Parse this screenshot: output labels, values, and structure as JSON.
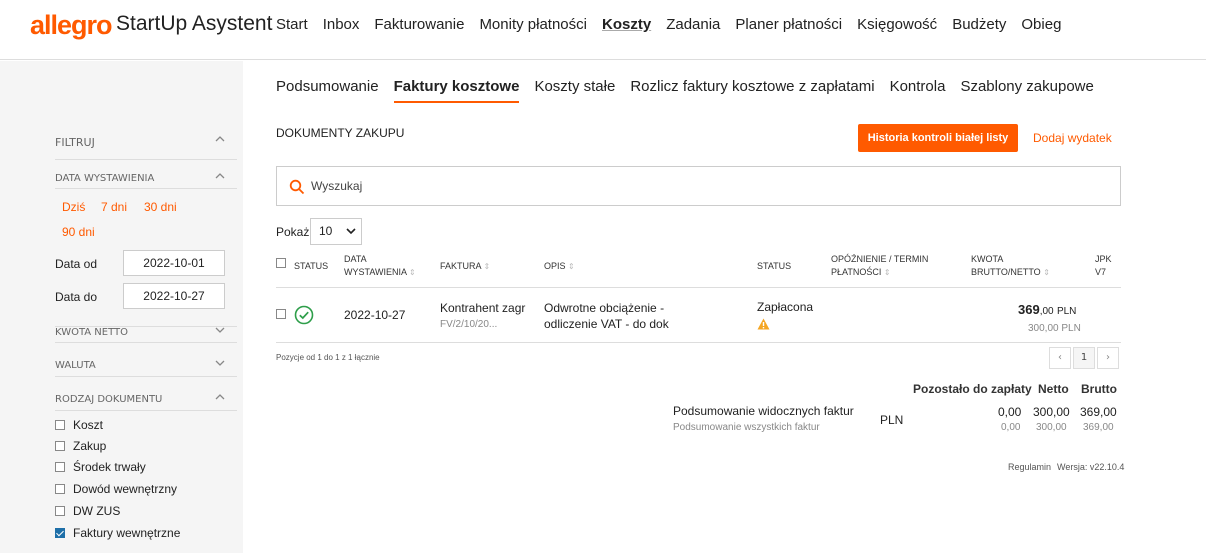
{
  "header": {
    "logo": "allegro",
    "app_name": "StartUp Asystent",
    "nav": [
      "Start",
      "Inbox",
      "Fakturowanie",
      "Monity płatności",
      "Koszty",
      "Zadania",
      "Planer płatności",
      "Księgowość",
      "Budżety",
      "Obieg"
    ],
    "active_nav": "Koszty"
  },
  "subnav": {
    "items": [
      "Podsumowanie",
      "Faktury kosztowe",
      "Koszty stałe",
      "Rozlicz faktury kosztowe z zapłatami",
      "Kontrola",
      "Szablony zakupowe"
    ],
    "active": "Faktury kosztowe"
  },
  "sidebar": {
    "filter_title": "FILTRUJ",
    "date_section": "DATA WYSTAWIENIA",
    "quick": [
      "Dziś",
      "7 dni",
      "30 dni",
      "90 dni"
    ],
    "date_from_label": "Data od",
    "date_from": "2022-10-01",
    "date_to_label": "Data do",
    "date_to": "2022-10-27",
    "net_amount": "KWOTA NETTO",
    "currency": "WALUTA",
    "doc_type": "RODZAJ DOKUMENTU",
    "doc_types": [
      {
        "label": "Koszt",
        "checked": false
      },
      {
        "label": "Zakup",
        "checked": false
      },
      {
        "label": "Środek trwały",
        "checked": false
      },
      {
        "label": "Dowód wewnętrzny",
        "checked": false
      },
      {
        "label": "DW ZUS",
        "checked": false
      },
      {
        "label": "Faktury wewnętrzne",
        "checked": true
      }
    ]
  },
  "main": {
    "section_title": "DOKUMENTY ZAKUPU",
    "btn_history": "Historia kontroli białej listy",
    "btn_add": "Dodaj wydatek",
    "search_placeholder": "Wyszukaj",
    "show_label": "Pokaż",
    "page_size": "10",
    "columns": {
      "status": "STATUS",
      "date_1": "DATA",
      "date_2": "WYSTAWIENIA",
      "invoice": "FAKTURA",
      "desc": "OPIS",
      "status2": "STATUS",
      "delay_1": "OPÓŹNIENIE / TERMIN",
      "delay_2": "PŁATNOŚCI",
      "amount_1": "KWOTA",
      "amount_2": "BRUTTO/NETTO",
      "jpk_1": "JPK",
      "jpk_2": "V7"
    },
    "row": {
      "date": "2022-10-27",
      "contractor": "Kontrahent zagr",
      "invoice_no": "FV/2/10/20...",
      "desc_1": "Odwrotne obciążenie -",
      "desc_2": "odliczenie VAT - do dok",
      "status": "Zapłacona",
      "gross_int": "369",
      "gross_dec": ",00",
      "gross_cur": "PLN",
      "net": "300,00 PLN"
    },
    "positions": "Pozycje od 1 do 1 z 1 łącznie",
    "page_prev": "‹",
    "page_current": "1",
    "page_next": "›"
  },
  "summary": {
    "col_remaining": "Pozostało do zapłaty",
    "col_net": "Netto",
    "col_gross": "Brutto",
    "label_visible": "Podsumowanie widocznych faktur",
    "label_all": "Podsumowanie wszystkich faktur",
    "currency": "PLN",
    "visible": {
      "remaining": "0,00",
      "net": "300,00",
      "gross": "369,00"
    },
    "all": {
      "remaining": "0,00",
      "net": "300,00",
      "gross": "369,00"
    }
  },
  "footer": {
    "terms": "Regulamin",
    "version": "Wersja: v22.10.4"
  },
  "colors": {
    "accent": "#ff5a00",
    "success": "#2e9e4a",
    "warning": "#f5a623"
  }
}
